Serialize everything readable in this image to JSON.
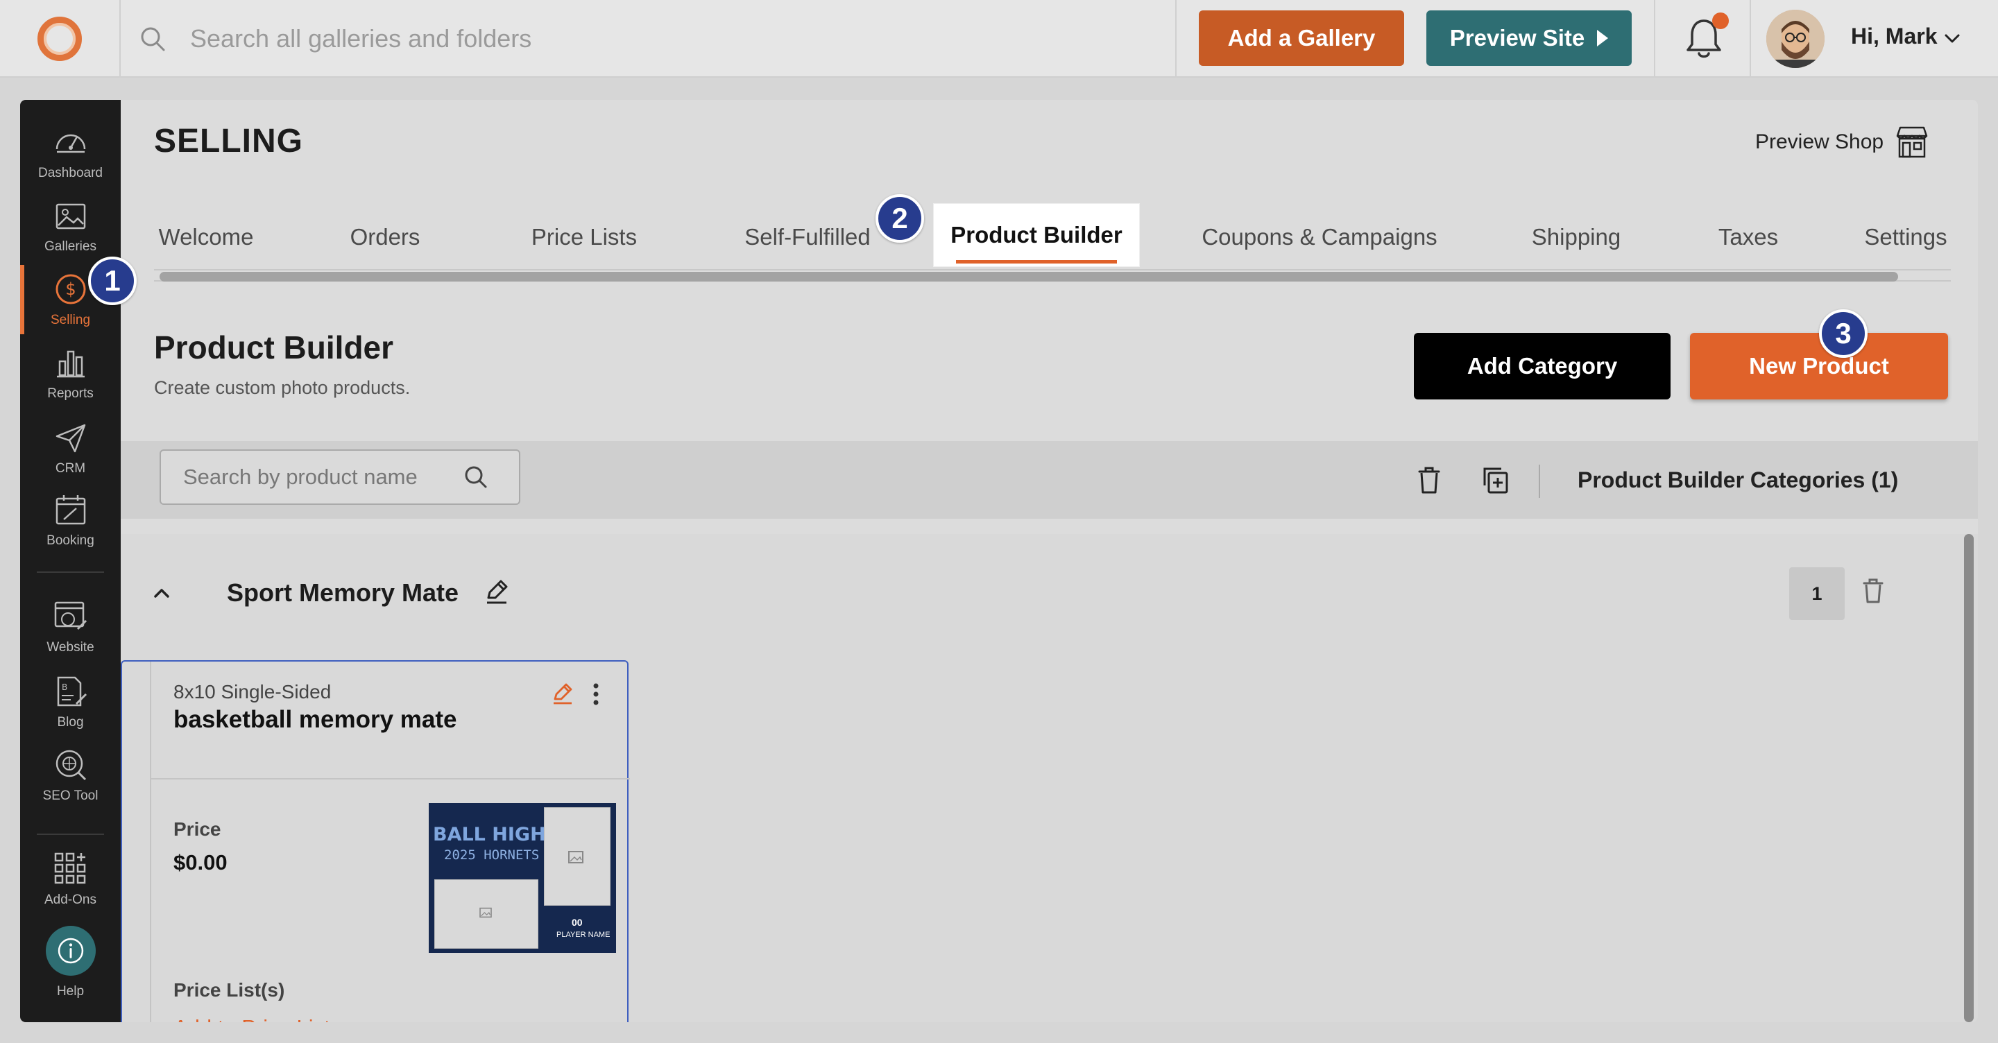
{
  "topbar": {
    "search_placeholder": "Search all galleries and folders",
    "add_gallery_label": "Add a Gallery",
    "preview_site_label": "Preview Site",
    "greeting": "Hi, Mark"
  },
  "sidebar": {
    "items": [
      {
        "label": "Dashboard",
        "icon": "speedometer-icon"
      },
      {
        "label": "Galleries",
        "icon": "image-icon"
      },
      {
        "label": "Selling",
        "icon": "dollar-circle-icon",
        "active": true
      },
      {
        "label": "Reports",
        "icon": "bar-chart-icon"
      },
      {
        "label": "CRM",
        "icon": "paper-plane-icon"
      },
      {
        "label": "Booking",
        "icon": "calendar-icon"
      },
      {
        "label": "Website",
        "icon": "website-icon"
      },
      {
        "label": "Blog",
        "icon": "blog-icon"
      },
      {
        "label": "SEO Tool",
        "icon": "globe-search-icon"
      },
      {
        "label": "Add-Ons",
        "icon": "grid-plus-icon"
      },
      {
        "label": "Help",
        "icon": "info-icon"
      }
    ]
  },
  "page": {
    "title": "SELLING",
    "preview_shop": "Preview Shop"
  },
  "tabs": [
    {
      "label": "Welcome"
    },
    {
      "label": "Orders"
    },
    {
      "label": "Price Lists"
    },
    {
      "label": "Self-Fulfilled"
    },
    {
      "label": "Product Builder",
      "active": true
    },
    {
      "label": "Coupons & Campaigns"
    },
    {
      "label": "Shipping"
    },
    {
      "label": "Taxes"
    },
    {
      "label": "Settings"
    }
  ],
  "section": {
    "title": "Product Builder",
    "subtitle": "Create custom photo products.",
    "add_category": "Add Category",
    "new_product": "New Product"
  },
  "toolbar": {
    "search_placeholder": "Search by product name",
    "categories_label": "Product Builder Categories (1)"
  },
  "category": {
    "name": "Sport Memory Mate",
    "count": "1"
  },
  "product": {
    "size": "8x10 Single-Sided",
    "name": "basketball memory mate",
    "price_label": "Price",
    "price": "$0.00",
    "thumb_title": "BALL HIGH",
    "thumb_subtitle": "2025 HORNETS",
    "thumb_number": "00",
    "thumb_player": "PLAYER NAME",
    "price_lists_label": "Price List(s)",
    "add_to_price_list": "Add to Price List"
  },
  "markers": [
    "1",
    "2",
    "3"
  ],
  "colors": {
    "brand_orange": "#e0622a",
    "teal": "#2e6e73",
    "marker_blue": "#273c8e",
    "sidebar_bg": "#1c1c1c"
  }
}
